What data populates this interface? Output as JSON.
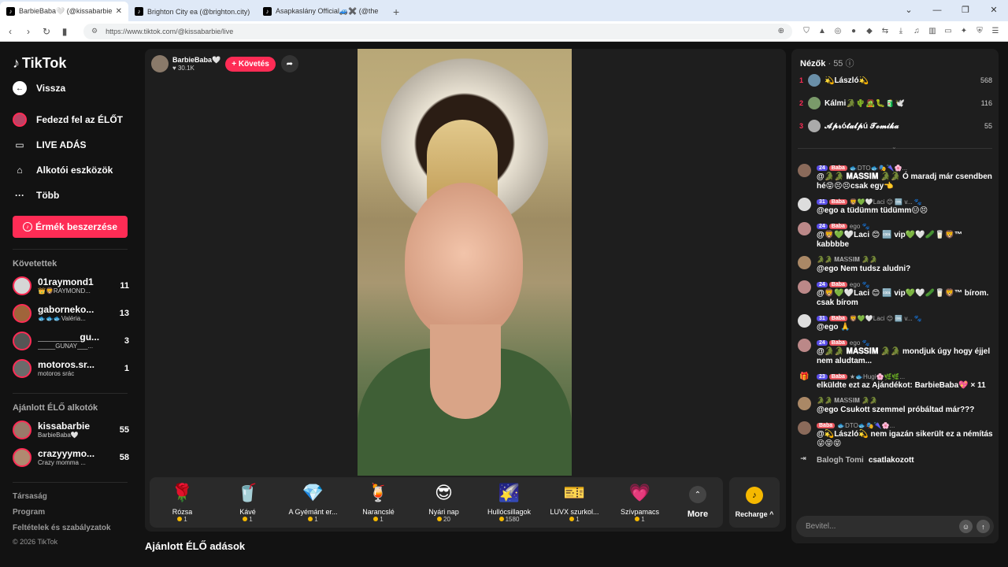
{
  "browser": {
    "tabs": [
      {
        "title": "BarbieBaba🤍 (@kissabarbie",
        "close": "✕"
      },
      {
        "title": "Brighton City ea (@brighton.city) ÉLŐ",
        "close": ""
      },
      {
        "title": "Asapkaslány Official🚙✖️ (@theresi",
        "close": ""
      }
    ],
    "url": "https://www.tiktok.com/@kissabarbie/live"
  },
  "sidebar": {
    "logo": "TikTok",
    "back": "Vissza",
    "nav": [
      {
        "label": "Fedezd fel az ÉLŐT"
      },
      {
        "label": "LIVE ADÁS"
      },
      {
        "label": "Alkotói eszközök"
      },
      {
        "label": "Több"
      }
    ],
    "coins_button": "Érmék beszerzése",
    "following_title": "Követettek",
    "following": [
      {
        "name": "01raymond1",
        "sub": "👑🦁RAYMOND...",
        "count": "11"
      },
      {
        "name": "gaborneko...",
        "sub": "🐟🐟🐟Valéria...",
        "count": "13"
      },
      {
        "name": "________gu...",
        "sub": "_____GUNAY___...",
        "count": "3"
      },
      {
        "name": "motoros.sr...",
        "sub": "motoros srác",
        "count": "1"
      }
    ],
    "recommended_title": "Ajánlott ÉLŐ alkotók",
    "recommended": [
      {
        "name": "kissabarbie",
        "sub": "BarbieBaba🤍",
        "count": "55"
      },
      {
        "name": "crazyyymo...",
        "sub": "Crazy momma ...",
        "count": "58"
      }
    ],
    "footer": [
      "Társaság",
      "Program",
      "Feltételek és szabályzatok"
    ],
    "copyright": "© 2026 TikTok"
  },
  "stream": {
    "host_name": "BarbieBaba🤍",
    "host_likes": "♥ 30.1K",
    "follow_label": "+ Követés",
    "gifts": [
      {
        "name": "Rózsa",
        "price": "1",
        "icon": "🌹"
      },
      {
        "name": "Kávé",
        "price": "1",
        "icon": "🥤"
      },
      {
        "name": "A Gyémánt er...",
        "price": "1",
        "icon": "💎"
      },
      {
        "name": "Narancslé",
        "price": "1",
        "icon": "🍹"
      },
      {
        "name": "Nyári nap",
        "price": "20",
        "icon": "😎"
      },
      {
        "name": "Hullócsillagok",
        "price": "1580",
        "icon": "🌠"
      },
      {
        "name": "LUVX szurkol...",
        "price": "1",
        "icon": "🎫"
      },
      {
        "name": "Szívpamacs",
        "price": "1",
        "icon": "💗"
      }
    ],
    "more_label": "More",
    "recharge_label": "Recharge ^"
  },
  "recommended_section": "Ajánlott ÉLŐ adások",
  "chat": {
    "viewers_title": "Nézők",
    "viewers_count": "· 55",
    "top": [
      {
        "rank": "1",
        "name": "💫László💫",
        "score": "568"
      },
      {
        "rank": "2",
        "name": "Kálmi🐊🌵🧟🐛🧃🕊️",
        "score": "116"
      },
      {
        "rank": "3",
        "name": "𝓐𝓹𝓻ó𝓽𝓪𝓵𝓹ú 𝓣𝓸𝓶𝓲𝓴𝓪",
        "score": "55"
      }
    ],
    "messages": [
      {
        "lv": "24",
        "fan": "Baba",
        "head": "🐟DTO🐟🎭🌂🌸...",
        "text": "@🐊🐊 𝐌𝐀𝐒𝐒𝐈𝐌 🐊🐊 Ó maradj már csendben hé😝😣😣csak egy👈"
      },
      {
        "lv": "31",
        "fan": "Baba",
        "head": "🦁💚🤍Laci 😊 🆒 v... 🐾",
        "text": "@ego a tüdümm tüdümm😑😣"
      },
      {
        "lv": "24",
        "fan": "Baba",
        "head": "ego 🐾",
        "text": "@🦁💚🤍Laci 😊 🆒 vip💚🤍🥒🥛🦁™ kabbbbe"
      },
      {
        "lv": "",
        "fan": "",
        "head": "🐊🐊 𝐌𝐀𝐒𝐒𝐈𝐌 🐊🐊",
        "text": "@ego Nem tudsz aludni?"
      },
      {
        "lv": "24",
        "fan": "Baba",
        "head": "ego 🐾",
        "text": "@🦁💚🤍Laci 😊 🆒 vip💚🤍🥒🥛🦁™ bírom. csak bírom"
      },
      {
        "lv": "31",
        "fan": "Baba",
        "head": "🦁💚🤍Laci 😊 🆒 v... 🐾",
        "text": "@ego 🙏"
      },
      {
        "lv": "24",
        "fan": "Baba",
        "head": "ego 🐾",
        "text": "@🐊🐊 𝐌𝐀𝐒𝐒𝐈𝐌 🐊🐊 mondjuk úgy hogy éjjel nem aludtam..."
      },
      {
        "lv": "23",
        "fan": "Baba",
        "head": "★🐟Hugi🌸🌿🌿...",
        "text": "elküldte ezt az Ajándékot: BarbieBaba💖 × 11"
      },
      {
        "lv": "",
        "fan": "",
        "head": "🐊🐊 𝐌𝐀𝐒𝐒𝐈𝐌 🐊🐊",
        "text": "@ego Csukott szemmel próbáltad már???"
      },
      {
        "lv": "",
        "fan": "Baba",
        "head": "🐟DTO🐟🎭🌂🌸...",
        "text": "@💫László💫 nem igazán sikerült ez a némítás😜😝😝"
      }
    ],
    "join_user": "Balogh Tomi",
    "join_text": "csatlakozott",
    "input_placeholder": "Bevitel..."
  }
}
